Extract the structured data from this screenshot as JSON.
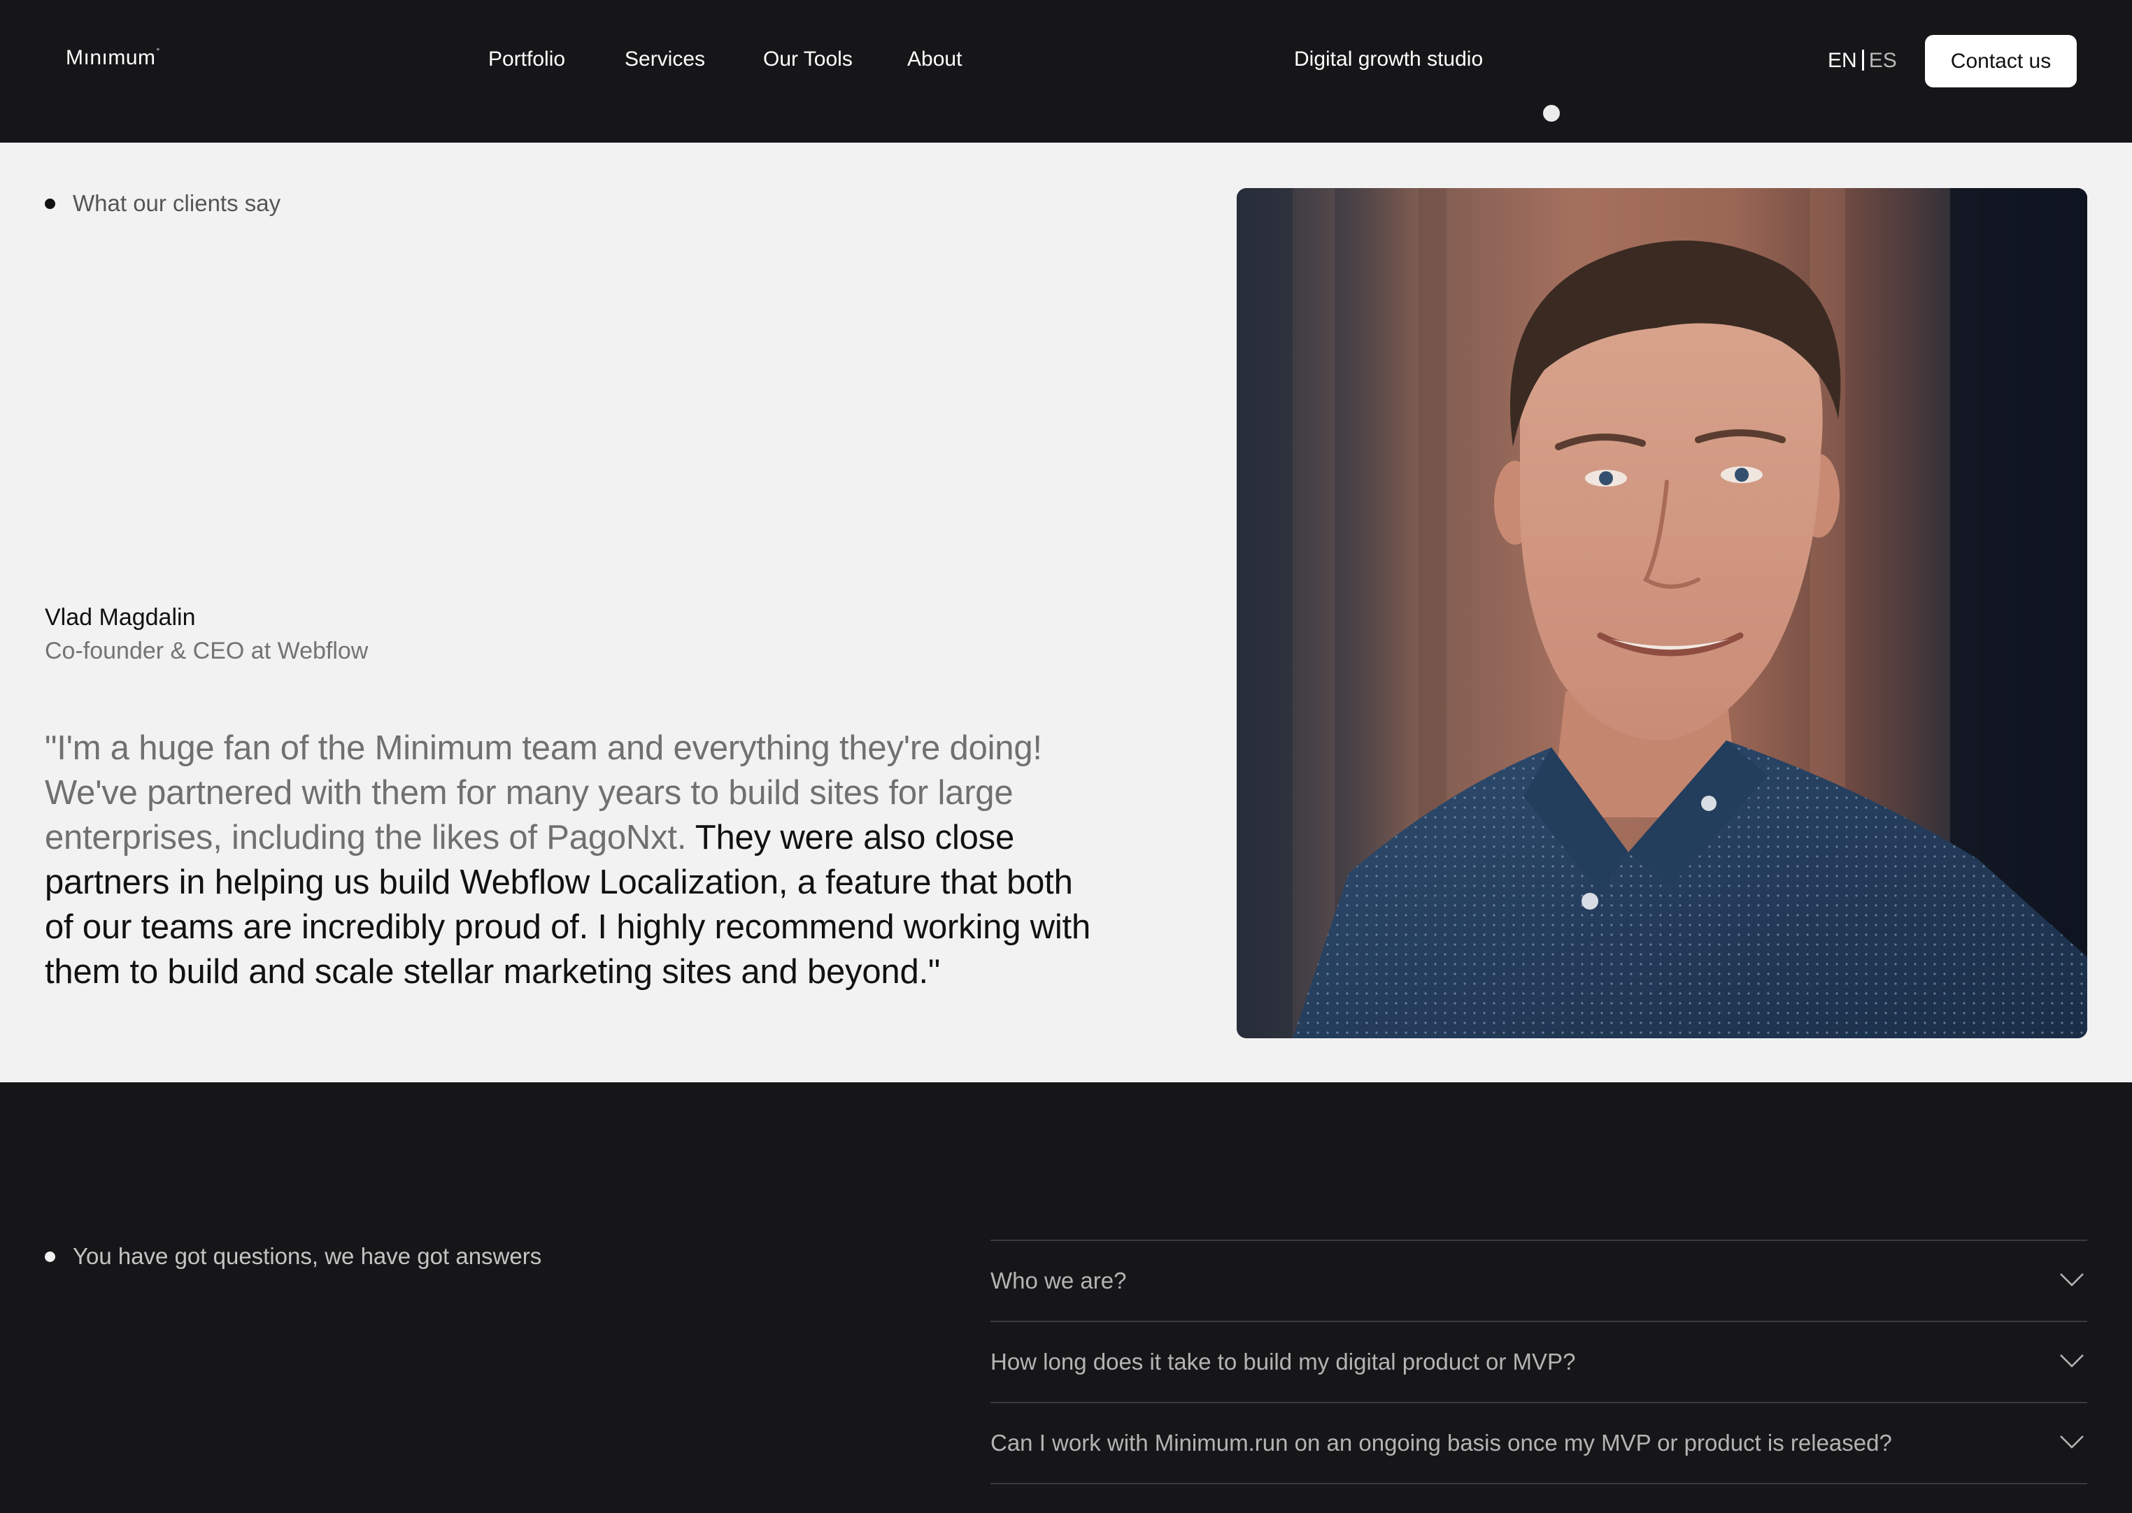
{
  "header": {
    "logo": "Mınımum",
    "logo_mark": "°",
    "nav": [
      {
        "label": "Portfolio"
      },
      {
        "label": "Services"
      },
      {
        "label": "Our Tools"
      },
      {
        "label": "About"
      }
    ],
    "tagline": "Digital growth studio",
    "lang_en": "EN",
    "lang_es": "ES",
    "contact_label": "Contact us"
  },
  "testimonial": {
    "section_label": "What our clients say",
    "author_name": "Vlad Magdalin",
    "author_role": "Co-founder & CEO at Webflow",
    "quote_muted": "\"I'm a huge fan of the Minimum team and everything they're doing! We've partnered with them for many years to build sites for large enterprises, including the likes of PagoNxt.",
    "quote_strong": " They were also close partners in helping us build Webflow Localization, a feature that both of our teams are incredibly proud of. I highly recommend working with them to build and scale stellar marketing sites and beyond.\""
  },
  "faq": {
    "section_label": "You have got questions, we have got answers",
    "items": [
      {
        "question": "Who we are?"
      },
      {
        "question": "How long does it take to build my digital product or MVP?"
      },
      {
        "question": "Can I work with Minimum.run on an ongoing basis once my MVP or product is released?"
      }
    ]
  },
  "colors": {
    "dark_bg": "#161618",
    "light_bg": "#f2f2f2",
    "text_dark": "#111111",
    "text_muted": "#707070",
    "white": "#ffffff"
  },
  "icons": {
    "faq_toggle": "chevron-down-icon",
    "bullet": "bullet-dot-icon"
  }
}
